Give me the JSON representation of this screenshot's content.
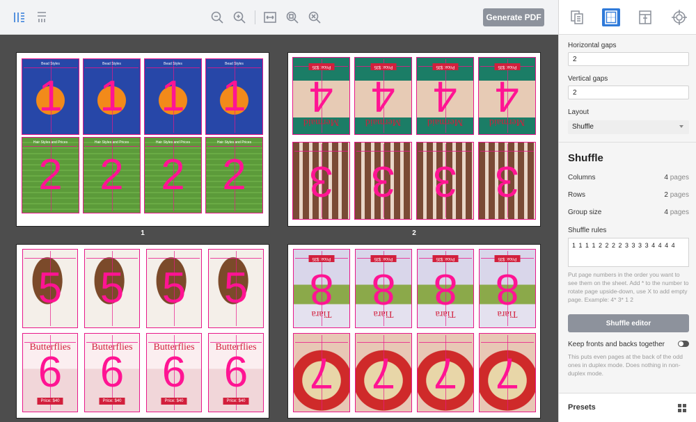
{
  "toolbar": {
    "generate_label": "Generate PDF",
    "icons": [
      "columns-icon",
      "rows-icon",
      "zoom-out-icon",
      "zoom-in-icon",
      "fit-width-icon",
      "zoom-fit-icon",
      "zoom-reset-icon"
    ]
  },
  "sheets": [
    {
      "label": "1",
      "top_row": [
        "1",
        "1",
        "1",
        "1"
      ],
      "bottom_row": [
        "2",
        "2",
        "2",
        "2"
      ],
      "top_style": "p1",
      "bottom_style": "p2",
      "top_title": "Bead Styles",
      "bottom_title": "Hair Styles and Prices"
    },
    {
      "label": "2",
      "top_row": [
        "4",
        "4",
        "4",
        "4"
      ],
      "bottom_row": [
        "3",
        "3",
        "3",
        "3"
      ],
      "top_style": "p4",
      "bottom_style": "p3",
      "top_caption": "Mermaid",
      "top_price": "Price: $35"
    },
    {
      "label": "",
      "top_row": [
        "5",
        "5",
        "5",
        "5"
      ],
      "bottom_row": [
        "6",
        "6",
        "6",
        "6"
      ],
      "top_style": "p5",
      "bottom_style": "p6",
      "bottom_caption": "Butterflies",
      "bottom_price": "Price: $40"
    },
    {
      "label": "",
      "top_row": [
        "8",
        "8",
        "8",
        "8"
      ],
      "bottom_row": [
        "7",
        "7",
        "7",
        "7"
      ],
      "top_style": "p8",
      "bottom_style": "p7",
      "top_caption": "Tiara",
      "top_price": "Price: $35"
    }
  ],
  "sidebar": {
    "tabs": [
      "pages-icon",
      "layout-grid-icon",
      "margins-icon",
      "marks-icon"
    ],
    "active_tab": 1,
    "horizontal_gaps_label": "Horizontal gaps",
    "horizontal_gaps_value": "2",
    "vertical_gaps_label": "Vertical gaps",
    "vertical_gaps_value": "2",
    "layout_label": "Layout",
    "layout_value": "Shuffle",
    "section_title": "Shuffle",
    "columns_label": "Columns",
    "columns_value": "4",
    "rows_label": "Rows",
    "rows_value": "2",
    "group_size_label": "Group size",
    "group_size_value": "4",
    "unit": "pages",
    "shuffle_rules_label": "Shuffle rules",
    "shuffle_rules_value": "1 1 1 1 2 2 2 2 3 3 3 3 4 4 4 4",
    "shuffle_help": "Put page numbers in the order you want to see them on the sheet. Add * to the number to rotate page upside-down, use X to add empty page. Example: 4* 3* 1 2",
    "shuffle_editor_label": "Shuffle editor",
    "keep_together_label": "Keep fronts and backs together",
    "keep_together_help": "This puts even pages at the back of the odd ones in duplex mode. Does nothing in non-duplex mode.",
    "presets_label": "Presets"
  }
}
